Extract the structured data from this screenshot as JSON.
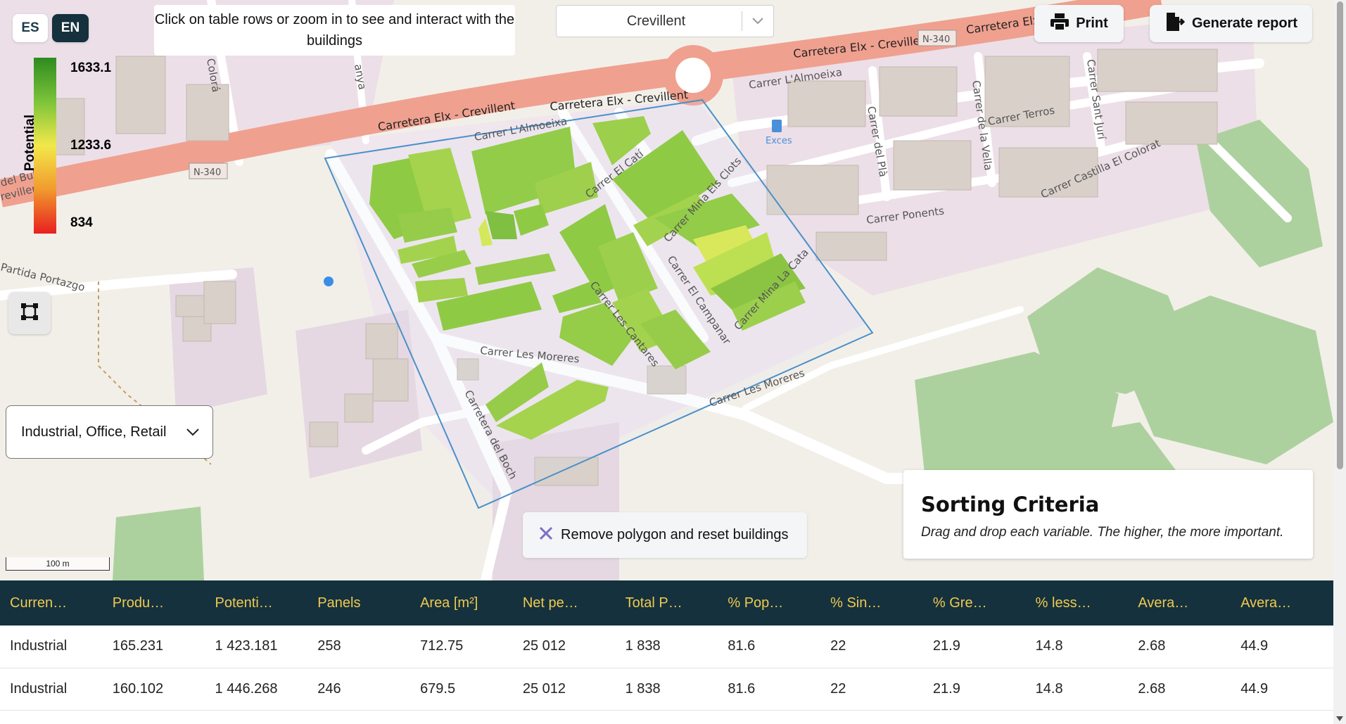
{
  "language": {
    "options": [
      "ES",
      "EN"
    ],
    "selected": "EN"
  },
  "legend": {
    "title": "Potential",
    "max": "1633.1",
    "mid": "1233.6",
    "min": "834",
    "colors": [
      "#2e8b1f",
      "#7cc43a",
      "#f2e84a",
      "#f19a2e",
      "#e81f1f"
    ]
  },
  "info_banner": "Click on table rows or zoom in to see and interact with the buildings",
  "municipality": {
    "selected": "Crevillent"
  },
  "toolbar": {
    "print_label": "Print",
    "report_label": "Generate report"
  },
  "building_type": {
    "selected": "Industrial, Office, Retail"
  },
  "scale": {
    "label": "100 m"
  },
  "remove_polygon": {
    "label": "Remove polygon and reset buildings"
  },
  "sorting": {
    "title": "Sorting Criteria",
    "subtitle": "Drag and drop each variable. The higher, the more important."
  },
  "map": {
    "labels": {
      "carretera_1": "Carretera Elx - Crevillent",
      "carretera_2": "Carretera Elx - Crevillent",
      "carretera_3": "Carretera Elx - Crevillent",
      "carretera_4": "Carretera Elx",
      "n340_1": "N-340",
      "n340_2": "N-340",
      "almoeixa_1": "Carrer L'Almoeixa",
      "almoeixa_2": "Carrer L'Almoeixa",
      "cati": "Carrer El Catí",
      "mina_clots": "Carrer Mina Els Clots",
      "campanar": "Carrer El Campanar",
      "mina_cata": "Carrer Mina La Cata",
      "cantares": "Carrer Les Cantares",
      "moreres_1": "Carrer Les Moreres",
      "moreres_2": "Carrer Les Moreres",
      "boch": "Carretera del Boch",
      "terros": "Carrer Terros",
      "pla": "Carrer del Plà",
      "vella": "Carrer de la Vella",
      "sant_juri": "Carrer Sant Jurí",
      "ponents": "Carrer Ponents",
      "castilla": "Carrer Castilla El Colorat",
      "portazgo": "Partida Portazgo",
      "colora": "Colorá",
      "excess": "Exces",
      "bul": "del Bul",
      "revillen": "revillen",
      "anya": "anya"
    }
  },
  "table": {
    "headers": [
      "Curren…",
      "Produ…",
      "Potenti…",
      "Panels",
      "Area [m²]",
      "Net pe…",
      "Total P…",
      "% Pop…",
      "% Sin…",
      "% Gre…",
      "% less…",
      "Avera…",
      "Avera…"
    ],
    "rows": [
      [
        "Industrial",
        "165.231",
        "1 423.181",
        "258",
        "712.75",
        "25 012",
        "1 838",
        "81.6",
        "22",
        "21.9",
        "14.8",
        "2.68",
        "44.9"
      ],
      [
        "Industrial",
        "160.102",
        "1 446.268",
        "246",
        "679.5",
        "25 012",
        "1 838",
        "81.6",
        "22",
        "21.9",
        "14.8",
        "2.68",
        "44.9"
      ]
    ]
  }
}
